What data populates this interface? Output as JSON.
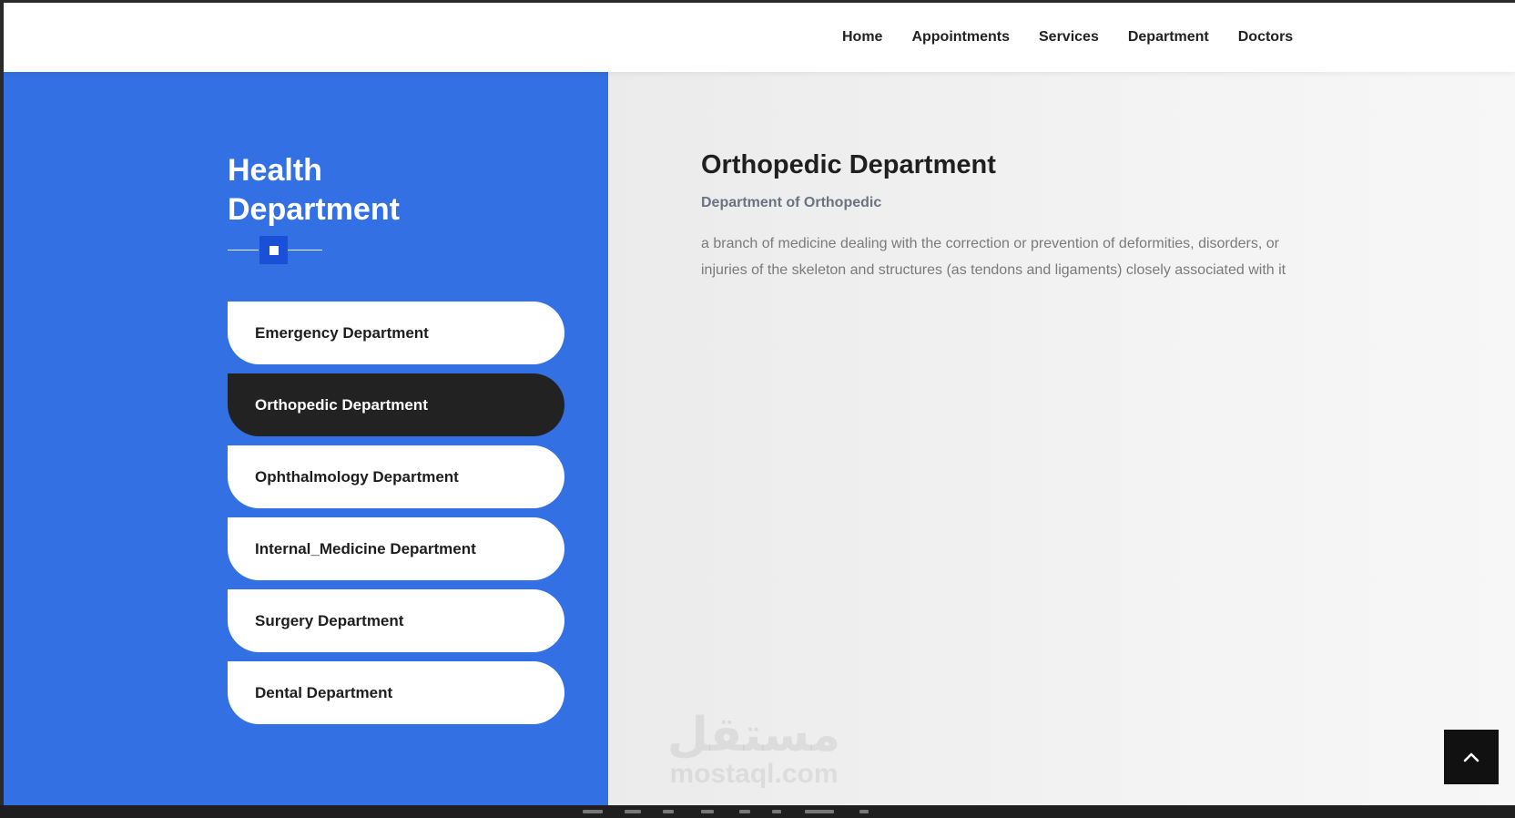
{
  "nav": {
    "items": [
      {
        "label": "Home"
      },
      {
        "label": "Appointments"
      },
      {
        "label": "Services"
      },
      {
        "label": "Department"
      },
      {
        "label": "Doctors"
      }
    ]
  },
  "sidebar": {
    "title_line1": "Health",
    "title_line2": "Department",
    "items": [
      {
        "label": "Emergency Department"
      },
      {
        "label": "Orthopedic Department"
      },
      {
        "label": "Ophthalmology Department"
      },
      {
        "label": "Internal_Medicine Department"
      },
      {
        "label": "Surgery Department"
      },
      {
        "label": "Dental Department"
      }
    ],
    "active_index": 1
  },
  "content": {
    "title": "Orthopedic Department",
    "subtitle": "Department of Orthopedic",
    "body": "a branch of medicine dealing with the correction or prevention of deformities, disorders, or injuries of the skeleton and structures (as tendons and ligaments) closely associated with it"
  },
  "watermark": {
    "arabic": "مستقل",
    "latin": "mostaql.com"
  },
  "colors": {
    "accent_blue": "#3370e3",
    "active_item": "#222222",
    "divider_box": "#1a4fd8"
  },
  "icons": {
    "scroll_top": "chevron-up-icon"
  }
}
